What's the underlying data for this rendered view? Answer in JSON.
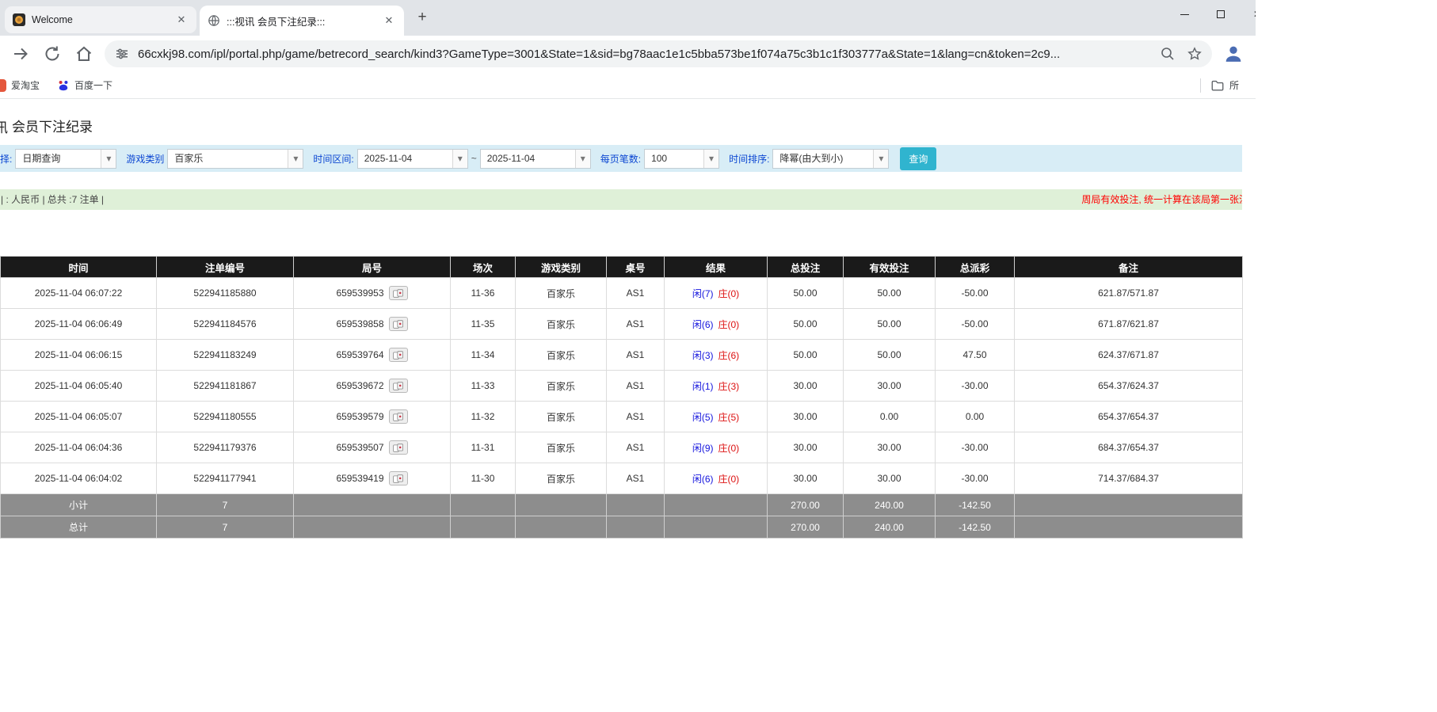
{
  "browser": {
    "tabs": [
      {
        "title": "Welcome",
        "favicon": "gold-emblem-icon",
        "active": false
      },
      {
        "title": ":::视讯 会员下注纪录:::",
        "favicon": "globe-icon",
        "active": true
      }
    ],
    "new_tab_label": "+",
    "toolbar": {
      "url": "66cxkj98.com/ipl/portal.php/game/betrecord_search/kind3?GameType=3001&State=1&sid=bg78aac1e1c5bba573be1f074a75c3b1c1f303777a&State=1&lang=cn&token=2c9..."
    },
    "bookmarks_bar": {
      "items": [
        "爱淘宝",
        "百度一下"
      ],
      "all_bookmarks_label": "所"
    }
  },
  "page": {
    "title": "会员下注纪录",
    "title_prefix_partial": "讯",
    "filters": {
      "query_label_partial": "择:",
      "query_type_value": "日期查询",
      "game_type_label": "游戏类别",
      "game_type_value": "百家乐",
      "date_range_label": "时间区间:",
      "date_from": "2025-11-04",
      "tilde": "~",
      "date_to": "2025-11-04",
      "page_size_label": "每页笔数:",
      "page_size_value": "100",
      "sort_label": "时间排序:",
      "sort_value": "降幂(由大到小)",
      "search_button": "查询"
    },
    "info_bar": {
      "left": "| : 人民币 | 总共 :7 注单 |",
      "right": "周局有效投注, 统一计算在该局第一张注"
    },
    "table": {
      "headers": [
        "时间",
        "注单编号",
        "局号",
        "场次",
        "游戏类别",
        "桌号",
        "结果",
        "总投注",
        "有效投注",
        "总派彩",
        "备注"
      ],
      "rows": [
        {
          "time": "2025-11-04 06:07:22",
          "bet_id": "522941185880",
          "round": "659539953",
          "session": "11-36",
          "game": "百家乐",
          "table_no": "AS1",
          "result_player": "闲(7)",
          "result_banker": "庄(0)",
          "total_bet": "50.00",
          "valid_bet": "50.00",
          "payout": "-50.00",
          "remark": "621.87/571.87"
        },
        {
          "time": "2025-11-04 06:06:49",
          "bet_id": "522941184576",
          "round": "659539858",
          "session": "11-35",
          "game": "百家乐",
          "table_no": "AS1",
          "result_player": "闲(6)",
          "result_banker": "庄(0)",
          "total_bet": "50.00",
          "valid_bet": "50.00",
          "payout": "-50.00",
          "remark": "671.87/621.87"
        },
        {
          "time": "2025-11-04 06:06:15",
          "bet_id": "522941183249",
          "round": "659539764",
          "session": "11-34",
          "game": "百家乐",
          "table_no": "AS1",
          "result_player": "闲(3)",
          "result_banker": "庄(6)",
          "total_bet": "50.00",
          "valid_bet": "50.00",
          "payout": "47.50",
          "remark": "624.37/671.87"
        },
        {
          "time": "2025-11-04 06:05:40",
          "bet_id": "522941181867",
          "round": "659539672",
          "session": "11-33",
          "game": "百家乐",
          "table_no": "AS1",
          "result_player": "闲(1)",
          "result_banker": "庄(3)",
          "total_bet": "30.00",
          "valid_bet": "30.00",
          "payout": "-30.00",
          "remark": "654.37/624.37"
        },
        {
          "time": "2025-11-04 06:05:07",
          "bet_id": "522941180555",
          "round": "659539579",
          "session": "11-32",
          "game": "百家乐",
          "table_no": "AS1",
          "result_player": "闲(5)",
          "result_banker": "庄(5)",
          "total_bet": "30.00",
          "valid_bet": "0.00",
          "payout": "0.00",
          "remark": "654.37/654.37"
        },
        {
          "time": "2025-11-04 06:04:36",
          "bet_id": "522941179376",
          "round": "659539507",
          "session": "11-31",
          "game": "百家乐",
          "table_no": "AS1",
          "result_player": "闲(9)",
          "result_banker": "庄(0)",
          "total_bet": "30.00",
          "valid_bet": "30.00",
          "payout": "-30.00",
          "remark": "684.37/654.37"
        },
        {
          "time": "2025-11-04 06:04:02",
          "bet_id": "522941177941",
          "round": "659539419",
          "session": "11-30",
          "game": "百家乐",
          "table_no": "AS1",
          "result_player": "闲(6)",
          "result_banker": "庄(0)",
          "total_bet": "30.00",
          "valid_bet": "30.00",
          "payout": "-30.00",
          "remark": "714.37/684.37"
        }
      ],
      "subtotal": {
        "label": "小计",
        "count": "7",
        "total_bet": "270.00",
        "valid_bet": "240.00",
        "payout": "-142.50"
      },
      "total": {
        "label": "总计",
        "count": "7",
        "total_bet": "270.00",
        "valid_bet": "240.00",
        "payout": "-142.50"
      }
    },
    "colors": {
      "table_header_bg": "#1a1a1a",
      "filter_bar_bg": "#d8edf6",
      "info_bar_bg": "#dff0d8",
      "link_blue": "#0a6ebd",
      "player_blue": "#1414dd",
      "banker_red": "#dd1111",
      "negative_red": "#e00000",
      "search_button_bg": "#30b4cf",
      "footer_bg": "#8d8d8d"
    }
  }
}
